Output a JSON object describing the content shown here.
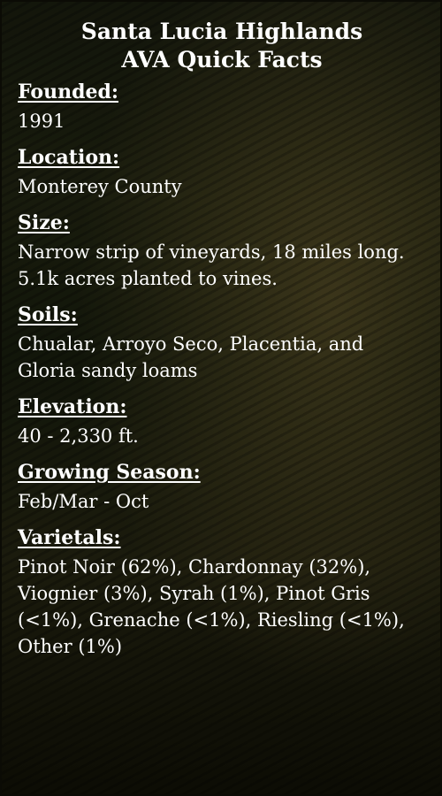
{
  "title_line1": "Santa Lucia Highlands",
  "title_line2": "AVA Quick Facts",
  "facts": [
    {
      "label": "Founded:",
      "value": "1991"
    },
    {
      "label": "Location:",
      "value": "Monterey County"
    },
    {
      "label": "Size:",
      "value": "Narrow strip of vineyards, 18 miles long. 5.1k acres planted to vines."
    },
    {
      "label": "Soils:",
      "value": "Chualar, Arroyo Seco, Placentia, and Gloria sandy loams"
    },
    {
      "label": "Elevation:",
      "value": "40 - 2,330 ft."
    },
    {
      "label": "Growing Season:",
      "value": "Feb/Mar - Oct"
    },
    {
      "label": "Varietals:",
      "value": "Pinot Noir (62%), Chardonnay (32%), Viognier (3%), Syrah (1%), Pinot Gris (<1%), Grenache (<1%), Riesling (<1%), Other (1%)"
    }
  ]
}
